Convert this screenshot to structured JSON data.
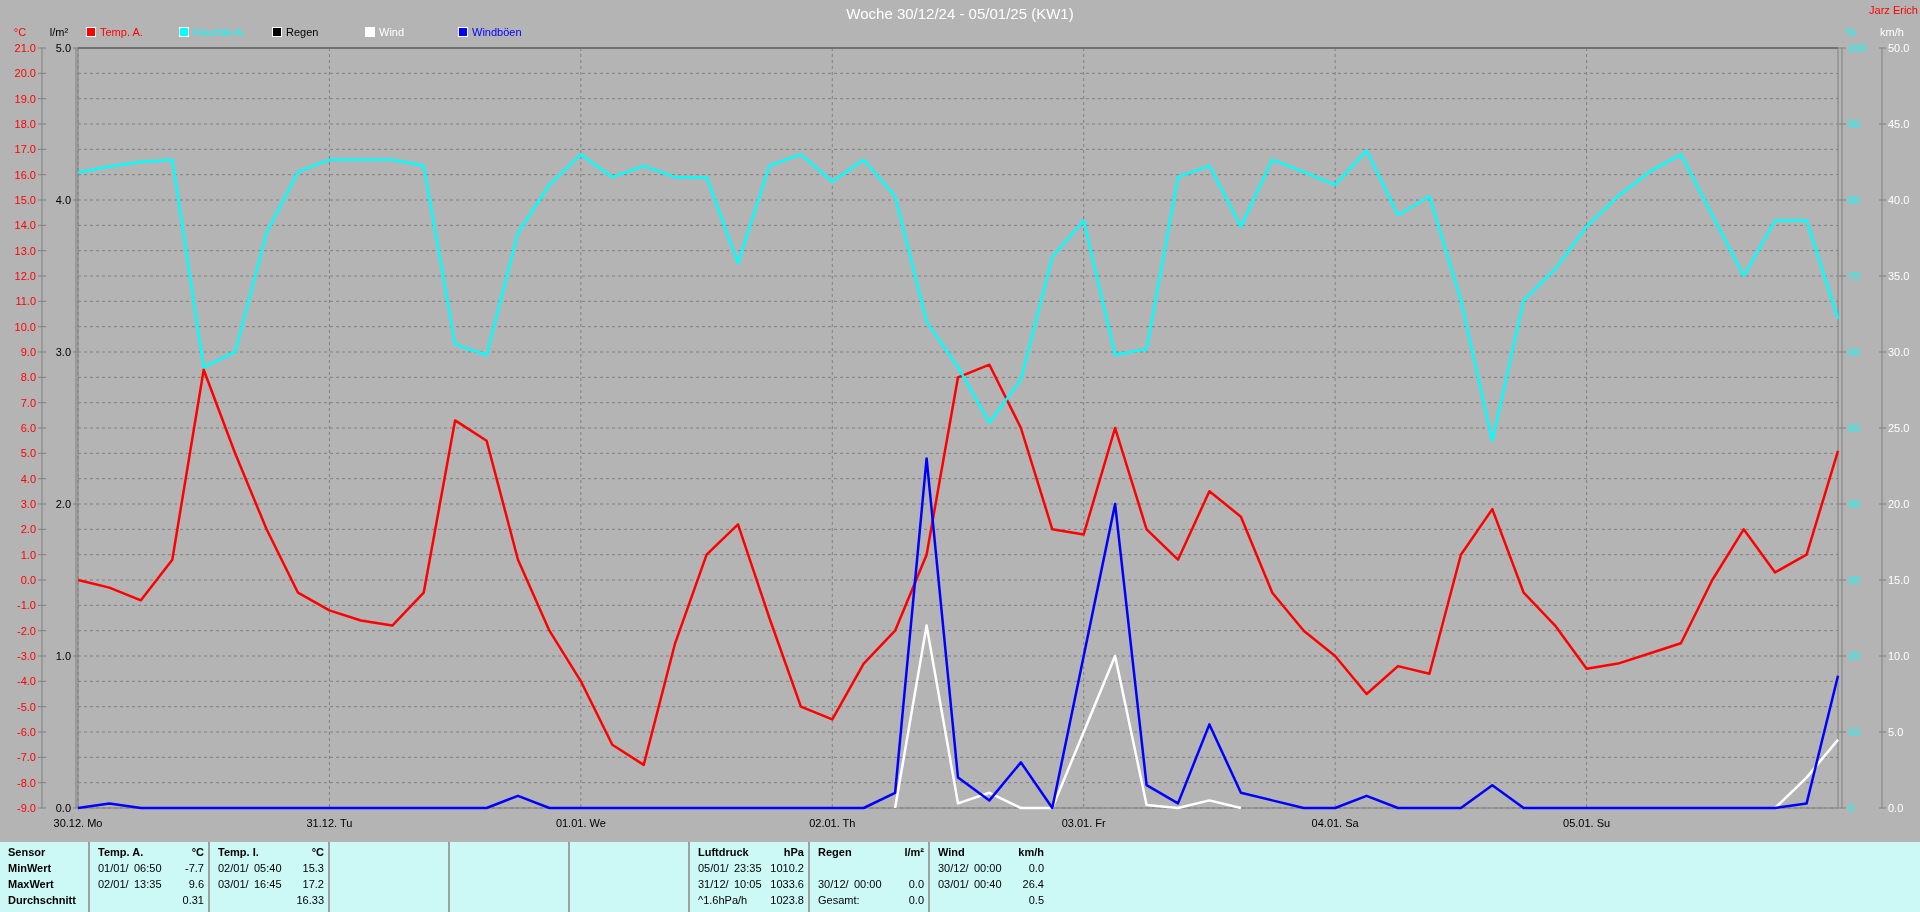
{
  "title": "Woche 30/12/24 - 05/01/25 (KW1)",
  "author": "Jarz Erich",
  "axes": {
    "left": [
      {
        "unit": "l/m²",
        "ticks": [
          "5.0",
          "4.0",
          "3.0",
          "2.0",
          "1.0",
          "0.0"
        ]
      }
    ],
    "right": [
      {
        "unit": "%"
      },
      {
        "unit": "km/h"
      }
    ]
  },
  "chart_data": {
    "type": "line",
    "grid": true,
    "categories": [
      "30.12. Mo",
      null,
      null,
      null,
      null,
      null,
      null,
      null,
      "31.12. Tu",
      null,
      null,
      null,
      null,
      null,
      null,
      null,
      "01.01. We",
      null,
      null,
      null,
      null,
      null,
      null,
      null,
      "02.01. Th",
      null,
      null,
      null,
      null,
      null,
      null,
      null,
      "03.01. Fr",
      null,
      null,
      null,
      null,
      null,
      null,
      null,
      "04.01. Sa",
      null,
      null,
      null,
      null,
      null,
      null,
      null,
      "05.01. Su",
      null,
      null,
      null,
      null,
      null,
      null,
      null,
      null
    ],
    "ylabel": "°C",
    "ylim": [
      -9,
      21
    ],
    "yticks": [
      {
        "value": -9,
        "label": "-9.0"
      },
      {
        "value": -8,
        "label": "-8.0"
      },
      {
        "value": -7,
        "label": "-7.0"
      },
      {
        "value": -6,
        "label": "-6.0"
      },
      {
        "value": -5,
        "label": "-5.0"
      },
      {
        "value": -4,
        "label": "-4.0"
      },
      {
        "value": -3,
        "label": "-3.0"
      },
      {
        "value": -2,
        "label": "-2.0"
      },
      {
        "value": -1,
        "label": "-1.0"
      },
      {
        "value": 0,
        "label": "0.0"
      },
      {
        "value": 1,
        "label": "1.0"
      },
      {
        "value": 2,
        "label": "2.0"
      },
      {
        "value": 3,
        "label": "3.0"
      },
      {
        "value": 4,
        "label": "4.0"
      },
      {
        "value": 5,
        "label": "5.0"
      },
      {
        "value": 6,
        "label": "6.0"
      },
      {
        "value": 7,
        "label": "7.0"
      },
      {
        "value": 8,
        "label": "8.0"
      },
      {
        "value": 9,
        "label": "9.0"
      },
      {
        "value": 10,
        "label": "10.0"
      },
      {
        "value": 11,
        "label": "11.0"
      },
      {
        "value": 12,
        "label": "12.0"
      },
      {
        "value": 13,
        "label": "13.0"
      },
      {
        "value": 14,
        "label": "14.0"
      },
      {
        "value": 15,
        "label": "15.0"
      },
      {
        "value": 16,
        "label": "16.0"
      },
      {
        "value": 17,
        "label": "17.0"
      },
      {
        "value": 18,
        "label": "18.0"
      },
      {
        "value": 19,
        "label": "19.0"
      },
      {
        "value": 20,
        "label": "20.0"
      },
      {
        "value": 21,
        "label": "21.0"
      }
    ],
    "y2lim": [
      0,
      100
    ],
    "y2ticks": [
      {
        "value": 0,
        "label": "0"
      },
      {
        "value": 10,
        "label": "10"
      },
      {
        "value": 20,
        "label": "20"
      },
      {
        "value": 30,
        "label": "30"
      },
      {
        "value": 40,
        "label": "40"
      },
      {
        "value": 50,
        "label": "50"
      },
      {
        "value": 60,
        "label": "60"
      },
      {
        "value": 70,
        "label": "70"
      },
      {
        "value": 80,
        "label": "80"
      },
      {
        "value": 90,
        "label": "90"
      },
      {
        "value": 100,
        "label": "100"
      }
    ],
    "y3lim": [
      0,
      50
    ],
    "y3ticks": [
      {
        "value": 0,
        "label": "0.0"
      },
      {
        "value": 5,
        "label": "5.0"
      },
      {
        "value": 10,
        "label": "10.0"
      },
      {
        "value": 15,
        "label": "15.0"
      },
      {
        "value": 20,
        "label": "20.0"
      },
      {
        "value": 25,
        "label": "25.0"
      },
      {
        "value": 30,
        "label": "30.0"
      },
      {
        "value": 35,
        "label": "35.0"
      },
      {
        "value": 40,
        "label": "40.0"
      },
      {
        "value": 45,
        "label": "45.0"
      },
      {
        "value": 50,
        "label": "50.0"
      }
    ],
    "series": [
      {
        "name": "Temp. A.",
        "color": "#ff0000",
        "values": [
          0.0,
          -0.3,
          -0.8,
          0.8,
          8.3,
          5.0,
          2.0,
          -0.5,
          -1.2,
          -1.6,
          -1.8,
          -0.5,
          6.3,
          5.5,
          0.8,
          -2.0,
          -4.0,
          -6.5,
          -7.3,
          -2.5,
          1.0,
          2.2,
          -1.5,
          -5.0,
          -5.5,
          -3.3,
          -2.0,
          1.0,
          8.0,
          8.5,
          6.0,
          2.0,
          1.8,
          6.0,
          2.0,
          0.8,
          3.5,
          2.5,
          -0.5,
          -2.0,
          -3.0,
          -4.5,
          -3.4,
          -3.7,
          1.0,
          2.8,
          -0.5,
          -1.8,
          -3.5,
          -3.3,
          -2.9,
          -2.5,
          0.0,
          2.0,
          0.3,
          1.0,
          5.1
        ]
      },
      {
        "name": "Feuchte A.",
        "color": "#00ffff",
        "axis": "y2",
        "values": [
          83.6,
          84.4,
          85.0,
          85.3,
          58.0,
          60.0,
          75.7,
          83.7,
          85.3,
          85.3,
          85.3,
          84.5,
          61.0,
          59.6,
          75.7,
          82.0,
          86.0,
          83.0,
          84.5,
          83.0,
          83.0,
          71.7,
          84.5,
          86.0,
          82.4,
          85.3,
          80.5,
          64.0,
          58.0,
          50.7,
          56.4,
          72.5,
          77.3,
          59.6,
          60.4,
          83.0,
          84.5,
          76.5,
          85.3,
          83.7,
          82.0,
          86.5,
          78.0,
          80.5,
          66.8,
          48.3,
          66.8,
          70.9,
          76.5,
          80.5,
          83.7,
          86.0,
          78.0,
          70.0,
          77.3,
          77.3,
          64.4
        ]
      },
      {
        "name": "Regen",
        "color": "#000000",
        "axis": "y3",
        "values": [
          null,
          null,
          null,
          null,
          null,
          null,
          null,
          null,
          null,
          null,
          null,
          null,
          null,
          null,
          null,
          null,
          null,
          null,
          null,
          null,
          null,
          null,
          null,
          null,
          null,
          null,
          null,
          null,
          null,
          null,
          null,
          null,
          null,
          null,
          null,
          null,
          null,
          null,
          null,
          null,
          null,
          null,
          null,
          null,
          null,
          null,
          null,
          null,
          null,
          null,
          null,
          null,
          null,
          null,
          null,
          null,
          null
        ]
      },
      {
        "name": "Wind",
        "color": "#ffffff",
        "axis": "y3",
        "values": [
          null,
          null,
          null,
          null,
          null,
          null,
          null,
          null,
          null,
          null,
          null,
          null,
          null,
          null,
          null,
          null,
          null,
          null,
          null,
          null,
          null,
          null,
          null,
          null,
          null,
          null,
          0,
          12,
          0.3,
          1.0,
          0,
          0,
          5,
          10,
          0.2,
          0,
          0.5,
          0,
          null,
          null,
          null,
          null,
          null,
          null,
          null,
          null,
          null,
          null,
          null,
          null,
          null,
          null,
          null,
          null,
          0,
          2,
          4.5
        ]
      },
      {
        "name": "Windböen",
        "color": "#0000ff",
        "axis": "y3",
        "values": [
          0,
          0.3,
          0,
          0,
          0,
          0,
          0,
          0,
          0,
          0,
          0,
          0,
          0,
          0,
          0.8,
          0,
          0,
          0,
          0,
          0,
          0,
          0,
          0,
          0,
          0,
          0,
          1.0,
          23,
          2,
          0.5,
          3,
          0,
          10,
          20,
          1.5,
          0.3,
          5.5,
          1,
          0.5,
          0,
          0,
          0.8,
          0,
          0,
          0,
          1.5,
          0,
          0,
          0,
          0,
          0,
          0,
          0,
          0,
          0,
          0.3,
          8.7
        ]
      }
    ]
  },
  "stats": {
    "row_labels": [
      "Sensor",
      "MinWert",
      "MaxWert",
      "Durchschnitt"
    ],
    "groups": [
      {
        "kind": "sensor",
        "name": "Temp. A.",
        "unit": "°C",
        "rows": [
          {
            "date": "01/01/",
            "time": "06:50",
            "value": "-7.7"
          },
          {
            "date": "02/01/",
            "time": "13:35",
            "value": "9.6"
          },
          {
            "value": "0.31"
          }
        ]
      },
      {
        "kind": "sensor",
        "name": "Temp. I.",
        "unit": "°C",
        "rows": [
          {
            "date": "02/01/",
            "time": "05:40",
            "value": "15.3"
          },
          {
            "date": "03/01/",
            "time": "16:45",
            "value": "17.2"
          },
          {
            "value": "16.33"
          }
        ]
      },
      {
        "kind": "empty"
      },
      {
        "kind": "empty"
      },
      {
        "kind": "empty"
      },
      {
        "kind": "sensor",
        "name": "Luftdruck",
        "unit": "hPa",
        "rows": [
          {
            "date": "05/01/",
            "time": "23:35",
            "value": "1010.2"
          },
          {
            "date": "31/12/",
            "time": "10:05",
            "value": "1033.6"
          },
          {
            "note": "^1.6hPa/h",
            "value": "1023.8"
          }
        ]
      },
      {
        "kind": "sensor",
        "name": "Regen",
        "unit": "l/m²",
        "rows": [
          {},
          {
            "date": "30/12/",
            "time": "00:00",
            "value": "0.0"
          },
          {
            "note": "Gesamt:",
            "value": "0.0"
          }
        ]
      },
      {
        "kind": "sensor",
        "name": "Wind",
        "unit": "km/h",
        "rows": [
          {
            "date": "30/12/",
            "time": "00:00",
            "value": "0.0"
          },
          {
            "date": "03/01/",
            "time": "00:40",
            "value": "26.4"
          },
          {
            "value": "0.5"
          }
        ]
      }
    ]
  }
}
